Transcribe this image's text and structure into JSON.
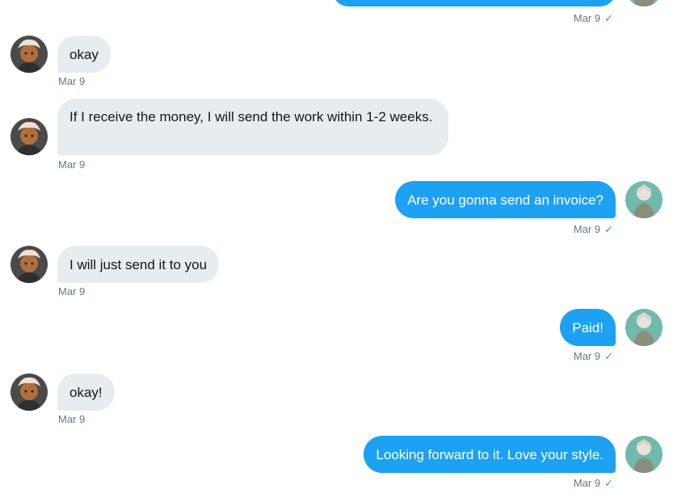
{
  "colors": {
    "outgoing_bubble": "#1da1f2",
    "incoming_bubble": "#e6ecf0",
    "timestamp": "#657786",
    "read_check": "#1da1f2"
  },
  "icons": {
    "incoming_avatar": "avatar-tan-character-icon",
    "outgoing_avatar": "avatar-green-character-icon",
    "read_receipt": "check-icon"
  },
  "messages": [
    {
      "direction": "out",
      "text": "",
      "time": "Mar 9",
      "read_mark": "✓"
    },
    {
      "direction": "in",
      "text": "okay",
      "time": "Mar 9"
    },
    {
      "direction": "in",
      "text": "If I receive the money, I will send the work within 1-2 weeks.",
      "time": "Mar 9"
    },
    {
      "direction": "out",
      "text": "Are you gonna send an invoice?",
      "time": "Mar 9",
      "read_mark": "✓"
    },
    {
      "direction": "in",
      "text": "I will just send it to you",
      "time": "Mar 9"
    },
    {
      "direction": "out",
      "text": "Paid!",
      "time": "Mar 9",
      "read_mark": "✓"
    },
    {
      "direction": "in",
      "text": "okay!",
      "time": "Mar 9"
    },
    {
      "direction": "out",
      "text": "Looking forward to it. Love your style.",
      "time": "Mar 9",
      "read_mark": "✓"
    }
  ]
}
